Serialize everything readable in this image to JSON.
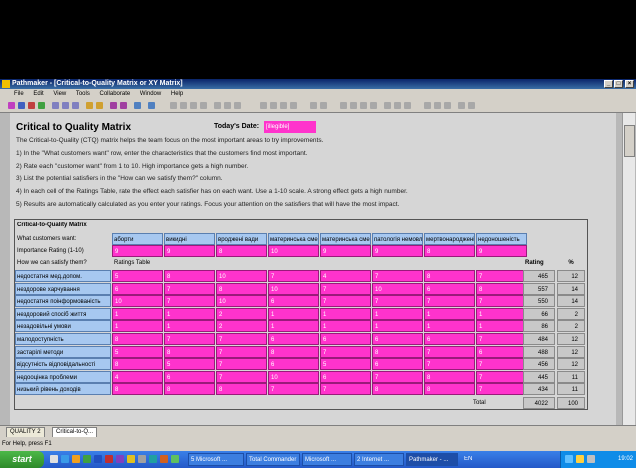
{
  "window": {
    "title": "Pathmaker - [Critical-to-Quality Matrix or XY Matrix]"
  },
  "menu": [
    "File",
    "Edit",
    "View",
    "Tools",
    "Collaborate",
    "Window",
    "Help"
  ],
  "document": {
    "heading": "Critical to Quality Matrix",
    "today_label": "Today's Date:",
    "today_value": "[illegible]",
    "intro": "The Critical-to-Quality (CTQ) matrix helps the team focus on the most important areas to try improvements.",
    "steps": [
      "1) In the \"What customers want\" row, enter the characteristics that the customers find most important.",
      "2) Rate each \"customer want\" from 1 to 10. High importance gets a high number.",
      "3) List the potential satisfiers in the \"How can we satisfy them?\" column.",
      "4) In each cell of the Ratings Table, rate the effect each satisfier has on each want. Use a 1-10 scale. A strong effect gets a high number.",
      "5) Results are automatically calculated as you enter your ratings. Focus your attention on the satisfiers that will have the most impact."
    ]
  },
  "matrix": {
    "title": "Critical-to-Quality Matrix",
    "wants_label": "What customers want:",
    "importance_label": "Importance Rating (1-10)",
    "how_label": "How we can satisfy them?",
    "ratings_table_label": "Ratings Table",
    "rating_header": "Rating",
    "pct_header": "%",
    "total_label": "Total",
    "total_rating": "4022",
    "total_pct": "100",
    "wants": [
      "аборти",
      "викидні",
      "вроджені вади",
      "материнська смертність",
      "материнська смертність",
      "патологія немовлят",
      "мертвонародженість",
      "недоношеність"
    ],
    "importance": [
      "9",
      "9",
      "8",
      "10",
      "9",
      "9",
      "8",
      "9"
    ],
    "rows": [
      {
        "satisfier": "недостатня мед.допом.",
        "cells": [
          "5",
          "8",
          "10",
          "7",
          "4",
          "7",
          "8",
          "7"
        ],
        "rating": "465",
        "pct": "12"
      },
      {
        "satisfier": "нездорове харчування",
        "cells": [
          "6",
          "7",
          "8",
          "10",
          "7",
          "10",
          "6",
          "8"
        ],
        "rating": "557",
        "pct": "14"
      },
      {
        "satisfier": "недостатня поінформованість",
        "cells": [
          "10",
          "7",
          "10",
          "6",
          "7",
          "7",
          "7",
          "7"
        ],
        "rating": "550",
        "pct": "14"
      },
      {
        "satisfier": "нездоровий спосіб життя",
        "cells": [
          "1",
          "1",
          "2",
          "1",
          "1",
          "1",
          "1",
          "1"
        ],
        "rating": "66",
        "pct": "2"
      },
      {
        "satisfier": "незадовільні умови",
        "cells": [
          "1",
          "1",
          "2",
          "1",
          "1",
          "1",
          "1",
          "1"
        ],
        "rating": "86",
        "pct": "2"
      },
      {
        "satisfier": "малодоступність",
        "cells": [
          "8",
          "7",
          "7",
          "6",
          "6",
          "6",
          "6",
          "7"
        ],
        "rating": "484",
        "pct": "12"
      },
      {
        "satisfier": "застарілі методи",
        "cells": [
          "5",
          "8",
          "7",
          "8",
          "7",
          "8",
          "7",
          "6"
        ],
        "rating": "488",
        "pct": "12"
      },
      {
        "satisfier": "відсутність відповідальності",
        "cells": [
          "8",
          "5",
          "7",
          "6",
          "5",
          "6",
          "7",
          "7"
        ],
        "rating": "456",
        "pct": "12"
      },
      {
        "satisfier": "недооцінка проблеми",
        "cells": [
          "4",
          "6",
          "7",
          "10",
          "6",
          "7",
          "8",
          "7"
        ],
        "rating": "445",
        "pct": "11"
      },
      {
        "satisfier": "низький рівень доходів",
        "cells": [
          "8",
          "8",
          "8",
          "7",
          "7",
          "8",
          "8",
          "7"
        ],
        "rating": "434",
        "pct": "11"
      }
    ]
  },
  "tabs": [
    "QUALITY 2",
    "Critical-to-Q..."
  ],
  "status_text": "For Help, press F1",
  "taskbar": {
    "start_label": "start",
    "tasks": [
      "5 Microsoft ...",
      "Total Commander",
      "Microsoft ...",
      "2 Internet ...",
      "Pathmaker - ..."
    ],
    "lang": "EN",
    "clock": "19:02"
  },
  "colors": {
    "title_bar": "#0a246a",
    "wants_fill": "#a7c8f0",
    "rating_cell_fill": "#ff33cc",
    "taskbar": "#2458c8",
    "start_button": "#2e8a2a"
  }
}
